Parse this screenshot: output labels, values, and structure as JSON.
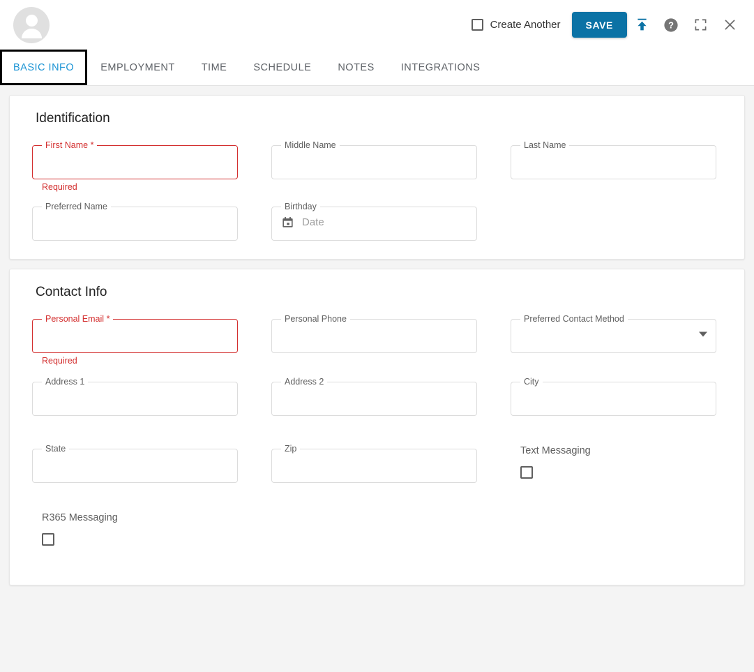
{
  "header": {
    "avatar_name": "employee-avatar",
    "create_another_label": "Create Another",
    "save_label": "SAVE",
    "upload_icon": "upload-icon",
    "help_icon": "help-icon",
    "fullscreen_icon": "fullscreen-icon",
    "close_icon": "close-icon",
    "accent_color": "#0b72a5",
    "error_color": "#d32f2f"
  },
  "tabs": [
    {
      "label": "BASIC INFO",
      "active": true
    },
    {
      "label": "EMPLOYMENT",
      "active": false
    },
    {
      "label": "TIME",
      "active": false
    },
    {
      "label": "SCHEDULE",
      "active": false
    },
    {
      "label": "NOTES",
      "active": false
    },
    {
      "label": "INTEGRATIONS",
      "active": false
    }
  ],
  "identification": {
    "title": "Identification",
    "first_name": {
      "label": "First Name",
      "required_marker": "*",
      "value": "",
      "error": "Required"
    },
    "middle_name": {
      "label": "Middle Name",
      "value": ""
    },
    "last_name": {
      "label": "Last Name",
      "value": ""
    },
    "preferred_name": {
      "label": "Preferred Name",
      "value": ""
    },
    "birthday": {
      "label": "Birthday",
      "value": "",
      "placeholder": "Date",
      "icon": "calendar-icon"
    }
  },
  "contact_info": {
    "title": "Contact Info",
    "personal_email": {
      "label": "Personal Email",
      "required_marker": "*",
      "value": "",
      "error": "Required"
    },
    "personal_phone": {
      "label": "Personal Phone",
      "value": ""
    },
    "preferred_contact_method": {
      "label": "Preferred Contact Method",
      "value": "",
      "icon": "chevron-down-icon"
    },
    "address_1": {
      "label": "Address 1",
      "value": ""
    },
    "address_2": {
      "label": "Address 2",
      "value": ""
    },
    "city": {
      "label": "City",
      "value": ""
    },
    "state": {
      "label": "State",
      "value": ""
    },
    "zip": {
      "label": "Zip",
      "value": ""
    },
    "text_messaging": {
      "label": "Text Messaging",
      "checked": false
    },
    "r365_messaging": {
      "label": "R365 Messaging",
      "checked": false
    }
  }
}
